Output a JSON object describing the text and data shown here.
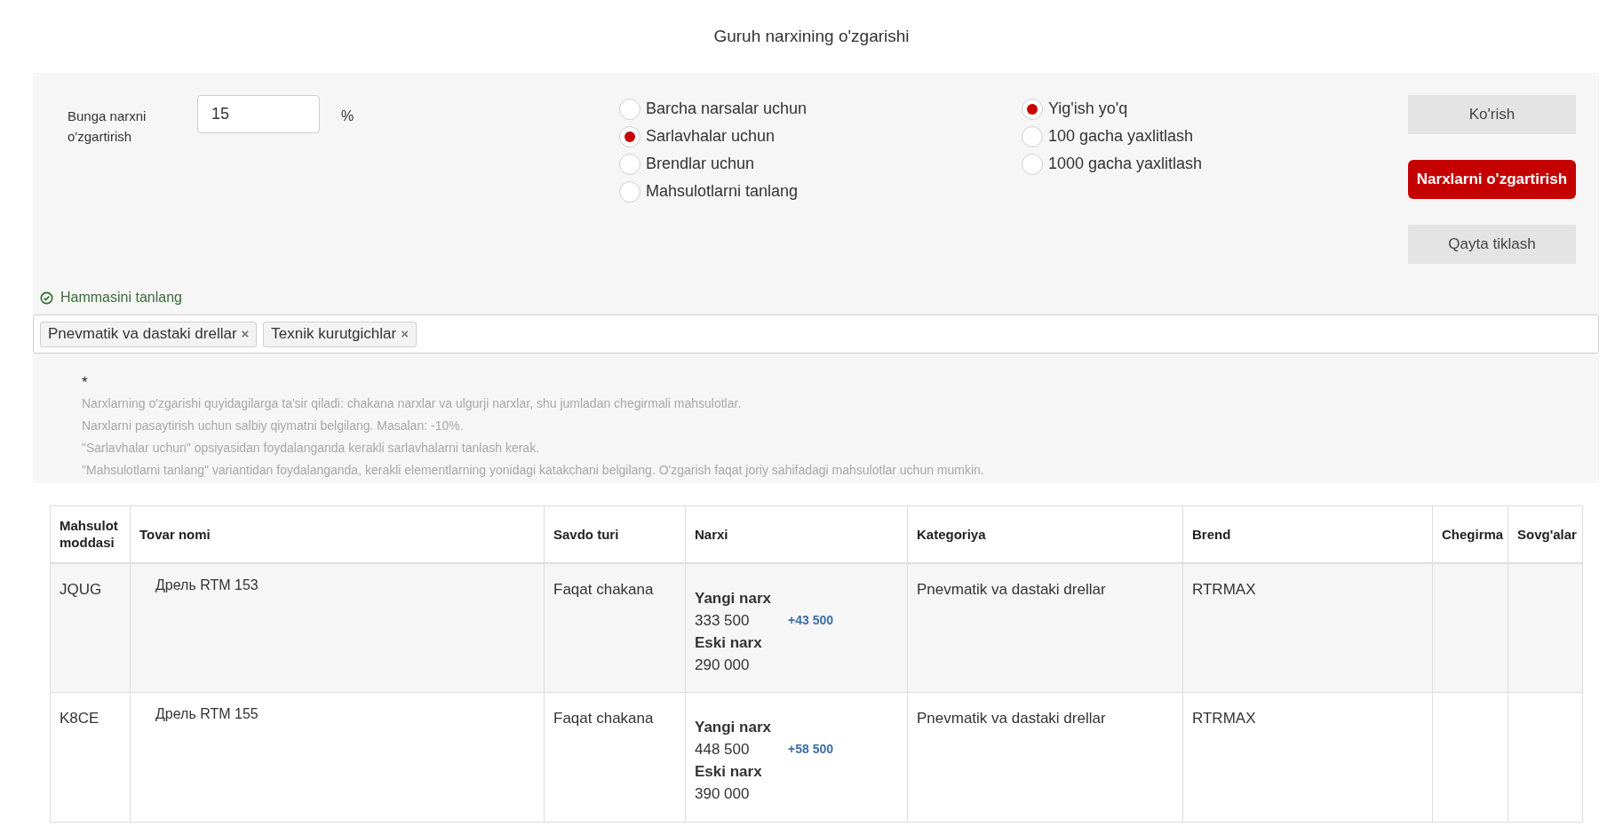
{
  "title": "Guruh narxining o'zgarishi",
  "change": {
    "label": "Bunga narxni o'zgartirish",
    "value": "15",
    "unit": "%"
  },
  "scope_options": [
    {
      "label": "Barcha narsalar uchun",
      "selected": false
    },
    {
      "label": "Sarlavhalar uchun",
      "selected": true
    },
    {
      "label": "Brendlar uchun",
      "selected": false
    },
    {
      "label": "Mahsulotlarni tanlang",
      "selected": false
    }
  ],
  "rounding_options": [
    {
      "label": "Yig'ish yo'q",
      "selected": true
    },
    {
      "label": "100 gacha yaxlitlash",
      "selected": false
    },
    {
      "label": "1000 gacha yaxlitlash",
      "selected": false
    }
  ],
  "buttons": [
    {
      "label": "Ko'rish",
      "kind": "secondary"
    },
    {
      "label": "Narxlarni o'zgartirish",
      "kind": "primary"
    },
    {
      "label": "Qayta tiklash",
      "kind": "secondary"
    }
  ],
  "select_all": "Hammasini tanlang",
  "tags": [
    {
      "label": "Pnevmatik va dastaki drellar",
      "remove": "×"
    },
    {
      "label": "Texnik kurutgichlar",
      "remove": "×"
    }
  ],
  "notes": {
    "mark": "*",
    "lines": [
      "Narxlarning o'zgarishi quyidagilarga ta'sir qiladi: chakana narxlar va ulgurji narxlar, shu jumladan chegirmali mahsulotlar.",
      "Narxlarni pasaytirish uchun salbiy qiymatni belgilang. Masalan: -10%.",
      "\"Sarlavhalar uchun\" opsiyasidan foydalanganda kerakli sarlavhalarni tanlash kerak.",
      "\"Mahsulotlarni tanlang\" variantidan foydalanganda, kerakli elementlarning yonidagi katakchani belgilang. O'zgarish faqat joriy sahifadagi mahsulotlar uchun mumkin."
    ]
  },
  "table": {
    "columns": [
      "Mahsulot moddasi",
      "Tovar nomi",
      "Savdo turi",
      "Narxi",
      "Kategoriya",
      "Brend",
      "Chegirma",
      "Sovg'alar"
    ],
    "rows": [
      {
        "sku": "JQUG",
        "name": "Дрель RTM 153",
        "sale_type": "Faqat chakana",
        "new_label": "Yangi narx",
        "new_price": "333 500",
        "diff": "+43 500",
        "old_label": "Eski narx",
        "old_price": "290 000",
        "category": "Pnevmatik va dastaki drellar",
        "brand": "RTRMAX"
      },
      {
        "sku": "K8CE",
        "name": "Дрель RTM 155",
        "sale_type": "Faqat chakana",
        "new_label": "Yangi narx",
        "new_price": "448 500",
        "diff": "+58 500",
        "old_label": "Eski narx",
        "old_price": "390 000",
        "category": "Pnevmatik va dastaki drellar",
        "brand": "RTRMAX"
      }
    ]
  }
}
